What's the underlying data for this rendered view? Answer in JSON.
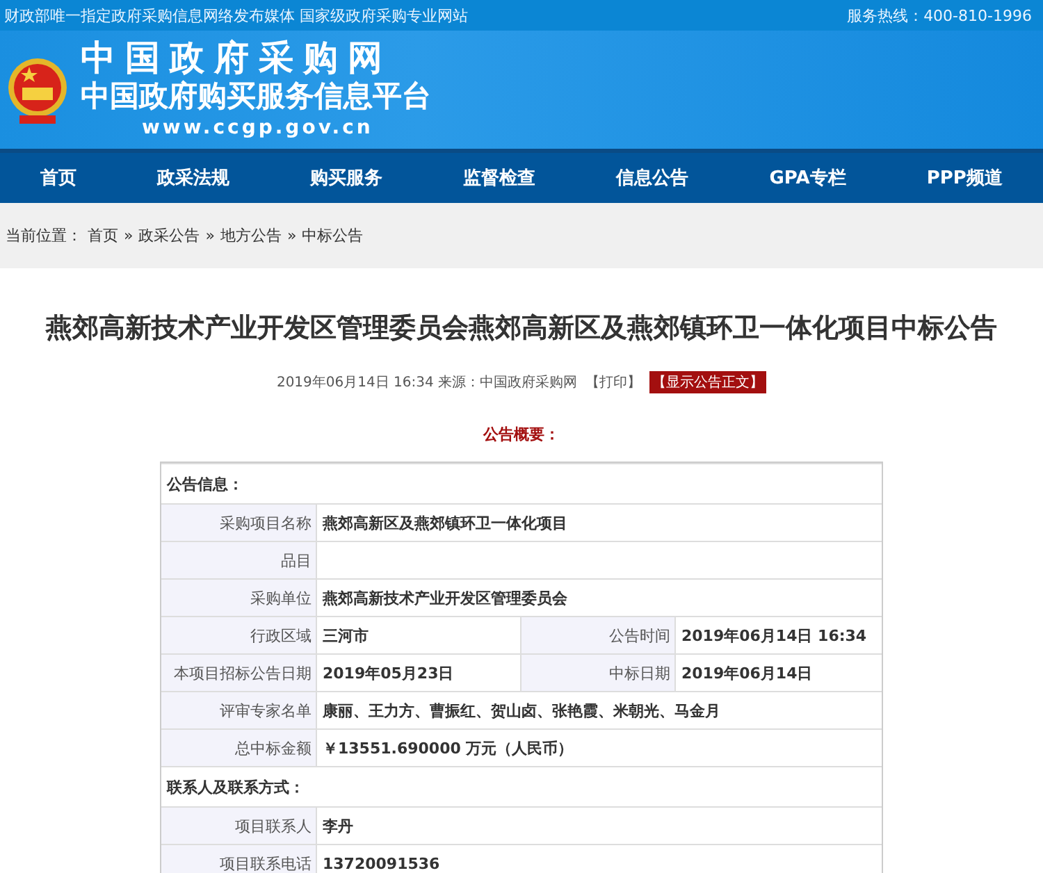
{
  "top_bar": {
    "slogan": "财政部唯一指定政府采购信息网络发布媒体 国家级政府采购专业网站",
    "hotline": "服务热线：400-810-1996"
  },
  "banner": {
    "title": "中国政府采购网",
    "subtitle": "中国政府购买服务信息平台",
    "url": "www.ccgp.gov.cn"
  },
  "nav": [
    {
      "label": "首页"
    },
    {
      "label": "政采法规"
    },
    {
      "label": "购买服务"
    },
    {
      "label": "监督检查"
    },
    {
      "label": "信息公告"
    },
    {
      "label": "GPA专栏"
    },
    {
      "label": "PPP频道"
    }
  ],
  "breadcrumb": {
    "prefix": "当前位置：",
    "items": [
      "首页",
      "政采公告",
      "地方公告",
      "中标公告"
    ],
    "separator": "»"
  },
  "article": {
    "title": "燕郊高新技术产业开发区管理委员会燕郊高新区及燕郊镇环卫一体化项目中标公告",
    "meta": "2019年06月14日 16:34 来源：中国政府采购网",
    "print_link": "【打印】",
    "show_text_button": "【显示公告正文】",
    "summary_heading": "公告概要："
  },
  "table": {
    "sections": [
      {
        "heading": "公告信息：",
        "rows": [
          {
            "kind": "single",
            "label": "采购项目名称",
            "value": "燕郊高新区及燕郊镇环卫一体化项目"
          },
          {
            "kind": "single",
            "label": "品目"
          },
          {
            "kind": "single",
            "label": "采购单位",
            "value": "燕郊高新技术产业开发区管理委员会"
          },
          {
            "kind": "pair",
            "label": "行政区域",
            "value": "三河市",
            "label_2": "公告时间",
            "value_2": "2019年06月14日 16:34"
          },
          {
            "kind": "pair",
            "label": "本项目招标公告日期",
            "value": "2019年05月23日",
            "label_2": "中标日期",
            "value_2": "2019年06月14日"
          },
          {
            "kind": "single",
            "label": "评审专家名单",
            "value": "康丽、王力方、曹振红、贺山卤、张艳霞、米朝光、马金月"
          },
          {
            "kind": "single",
            "label": "总中标金额",
            "value": "￥13551.690000 万元（人民币）"
          }
        ]
      },
      {
        "heading": "联系人及联系方式：",
        "rows": [
          {
            "kind": "single",
            "label": "项目联系人",
            "value": "李丹"
          },
          {
            "kind": "single",
            "label": "项目联系电话",
            "value": "13720091536"
          }
        ]
      }
    ]
  }
}
